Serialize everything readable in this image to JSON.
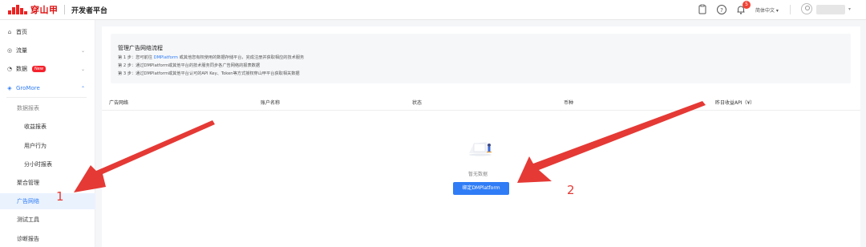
{
  "header": {
    "logo_text": "穿山甲",
    "platform_title": "开发者平台",
    "notification_count": "5",
    "language": "简体中文"
  },
  "sidebar": {
    "items": [
      {
        "label": "首页",
        "icon": "home-icon"
      },
      {
        "label": "流量",
        "icon": "traffic-icon"
      },
      {
        "label": "数据",
        "icon": "data-icon",
        "badge": "New"
      },
      {
        "label": "GroMore",
        "icon": "gromore-icon"
      }
    ],
    "gromore_sub": {
      "group_label": "数据报表",
      "report_items": [
        "收益报表",
        "用户行为",
        "分小时报表"
      ],
      "items": [
        "聚合管理",
        "广告网络",
        "测试工具",
        "诊断报告"
      ]
    }
  },
  "guide": {
    "title": "管理广告网络流程",
    "step1_prefix": "第 1 步：您可前往",
    "step1_link": "DMPlatform",
    "step1_suffix": "或其他您有权使用的数据存储平台，完成注册并获取相应的技术服务",
    "step2": "第 2 步：通过DMPlatform或其他平台的技术服务同步各广告网络的报表数据",
    "step3": "第 3 步：通过DMPlatform或其他平台认可的API Key、Token等方式授权穿山甲平台获取相关数据"
  },
  "table": {
    "columns": [
      "广告网络",
      "账户名称",
      "状态",
      "币种",
      "昨日收益API（¥）"
    ]
  },
  "empty": {
    "text": "暂无数据",
    "button": "绑定DMPlatform"
  },
  "annotations": {
    "label1": "1",
    "label2": "2",
    "color": "#e53935"
  },
  "colors": {
    "primary": "#2f7cf6",
    "brand": "#dd1111",
    "badge": "#f04134"
  }
}
